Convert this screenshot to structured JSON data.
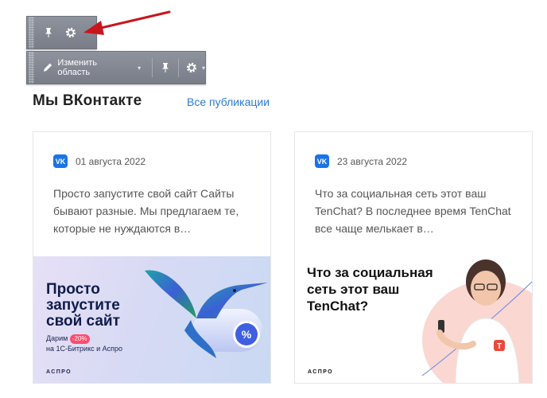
{
  "admin_panel": {
    "edit_area_label": "Изменить область",
    "icons": [
      "pin-icon",
      "gear-icon",
      "pencil-icon",
      "caret-down-icon"
    ]
  },
  "section": {
    "title": "Мы ВКонтакте",
    "all_link": "Все публикации"
  },
  "cards": [
    {
      "source_icon": "VK",
      "date": "01 августа 2022",
      "text": "Просто запустите свой сайт Сайты бывают разные. Мы предлагаем те, которые не нуждаются в…",
      "image": {
        "headline_lines": [
          "Просто",
          "запустите",
          "свой сайт"
        ],
        "sub_prefix": "Дарим",
        "badge": "-20%",
        "sub_line2": "на 1С-Битрикс и Аспро",
        "brand": "АСПРО"
      }
    },
    {
      "source_icon": "VK",
      "date": "23 августа 2022",
      "text": "Что за социальная сеть этот ваш TenChat? В последнее время TenChat все чаще мелькает в…",
      "image": {
        "headline_lines": [
          "Что за социальная",
          "сеть этот ваш",
          "TenChat?"
        ],
        "brand": "АСПРО"
      }
    }
  ],
  "colors": {
    "link": "#2a7ad3",
    "vk": "#1a73e8",
    "panel": "#828791",
    "arrow": "#c8161d"
  }
}
